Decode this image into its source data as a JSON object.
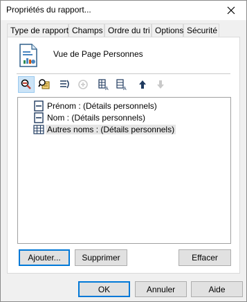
{
  "window": {
    "title": "Propriétés du rapport..."
  },
  "tabs": [
    {
      "label": "Type de rapport"
    },
    {
      "label": "Champs"
    },
    {
      "label": "Ordre du tri"
    },
    {
      "label": "Options"
    },
    {
      "label": "Sécurité"
    }
  ],
  "active_tab": "Type de rapport",
  "report": {
    "name": "Vue de Page Personnes"
  },
  "toolbar": {
    "buttons": [
      {
        "name": "search-fields-icon",
        "state": "pressed"
      },
      {
        "name": "search-data-icon",
        "state": "normal"
      },
      {
        "name": "align-right-icon",
        "state": "normal"
      },
      {
        "name": "add-circle-icon",
        "state": "disabled"
      },
      {
        "name": "table-column-a-icon",
        "state": "normal"
      },
      {
        "name": "field-a-icon",
        "state": "normal"
      },
      {
        "name": "move-up-icon",
        "state": "normal"
      },
      {
        "name": "move-down-icon",
        "state": "disabled"
      }
    ]
  },
  "fields": [
    {
      "label": "Prénom : (Détails personnels)",
      "icon": "field-icon"
    },
    {
      "label": "Nom : (Détails personnels)",
      "icon": "field-icon"
    },
    {
      "label": "Autres noms : (Détails personnels)",
      "icon": "table-icon",
      "selected": true
    }
  ],
  "actions": {
    "add": "Ajouter...",
    "remove": "Supprimer",
    "clear": "Effacer"
  },
  "footer": {
    "ok": "OK",
    "cancel": "Annuler",
    "help": "Aide"
  },
  "colors": {
    "accent": "#0078d7",
    "dialog_bg": "#f0f0f0",
    "button_bg": "#e1e1e1"
  }
}
